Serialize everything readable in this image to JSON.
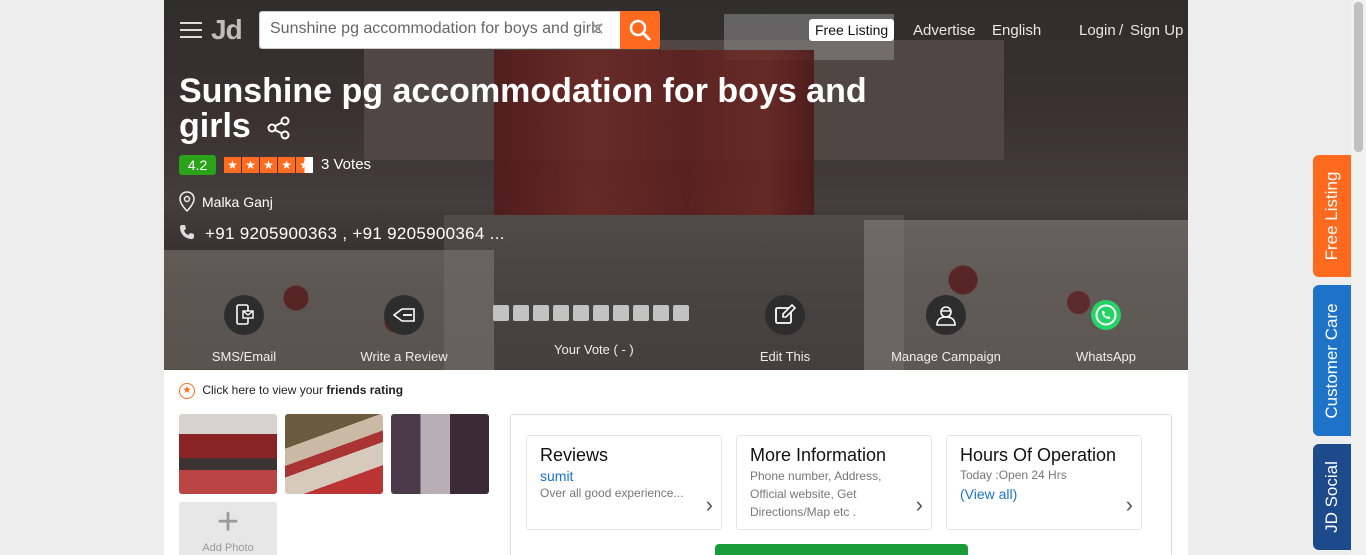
{
  "header": {
    "logo": "Jd",
    "search_value": "Sunshine pg accommodation for boys and girls",
    "free_listing": "Free Listing",
    "advertise": "Advertise",
    "language": "English",
    "login": "Login",
    "separator": "/",
    "signup": "Sign Up"
  },
  "business": {
    "title": "Sunshine pg accommodation for boys and girls",
    "rating": "4.2",
    "stars": 4.2,
    "votes": "3 Votes",
    "address": "Malka Ganj",
    "phones": "+91 9205900363 , +91 9205900364 ..."
  },
  "actions": {
    "sms_email": "SMS/Email",
    "write_review": "Write a Review",
    "your_vote": "Your Vote ( - )",
    "edit_this": "Edit This",
    "manage_campaign": "Manage Campaign",
    "whatsapp": "WhatsApp"
  },
  "friends": {
    "prefix": "Click here to view your",
    "bold": "friends rating"
  },
  "add_photo": "Add Photo",
  "cards": {
    "reviews": {
      "title": "Reviews",
      "reviewer": "sumit",
      "snippet": "Over all good experience..."
    },
    "more_info": {
      "title": "More Information",
      "desc": "Phone number, Address, Official website, Get Directions/Map etc ."
    },
    "hours": {
      "title": "Hours Of Operation",
      "today": "Today :Open 24 Hrs",
      "view_all": "(View all)"
    }
  },
  "side_tabs": {
    "free_listing": "Free Listing",
    "customer_care": "Customer Care",
    "jd_social": "JD Social"
  },
  "colors": {
    "accent": "#ff6a1f",
    "rating_green": "#2aa21a",
    "link_blue": "#1a73c9"
  }
}
